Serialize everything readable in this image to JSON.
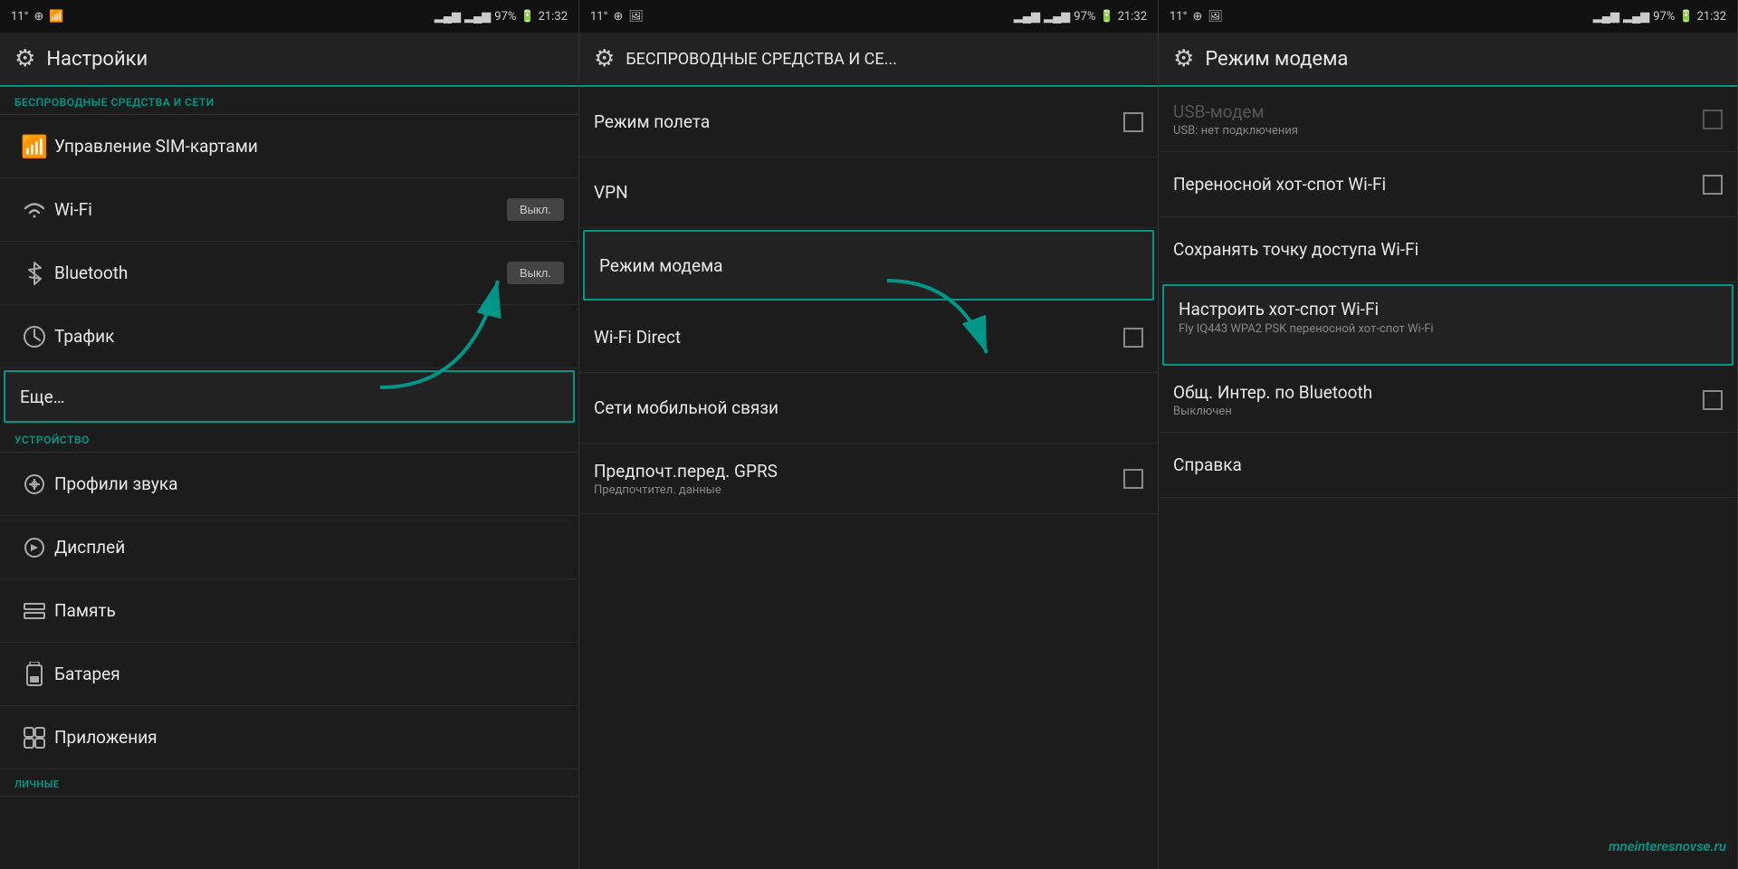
{
  "panels": [
    {
      "id": "panel1",
      "statusBar": {
        "left": "11°",
        "leftIcons": [
          "⊕",
          "📶"
        ],
        "signal": "▂▄▆",
        "signal2": "▂▄▆",
        "battery": "97%",
        "batteryIcon": "🔋",
        "time": "21:32"
      },
      "header": {
        "icon": "⚙",
        "title": "Настройки"
      },
      "sections": [
        {
          "label": "БЕСПРОВОДНЫЕ СРЕДСТВА И СЕТИ",
          "items": [
            {
              "icon": "📶",
              "iconType": "sim",
              "title": "Управление SIM-картами",
              "right": null,
              "subtitle": null,
              "highlighted": false
            },
            {
              "icon": "wifi",
              "title": "Wi-Fi",
              "right": "toggle",
              "toggleLabel": "Выкл.",
              "subtitle": null,
              "highlighted": false
            },
            {
              "icon": "bluetooth",
              "title": "Bluetooth",
              "right": "toggle",
              "toggleLabel": "Выкл.",
              "subtitle": null,
              "highlighted": false
            },
            {
              "icon": "traffic",
              "title": "Трафик",
              "right": null,
              "subtitle": null,
              "highlighted": false
            },
            {
              "icon": null,
              "title": "Еще…",
              "right": null,
              "subtitle": null,
              "highlighted": true
            }
          ]
        },
        {
          "label": "УСТРОЙСТВО",
          "items": [
            {
              "icon": "sound",
              "title": "Профили звука",
              "right": null,
              "subtitle": null,
              "highlighted": false
            },
            {
              "icon": "display",
              "title": "Дисплей",
              "right": null,
              "subtitle": null,
              "highlighted": false
            },
            {
              "icon": "memory",
              "title": "Память",
              "right": null,
              "subtitle": null,
              "highlighted": false
            },
            {
              "icon": "battery",
              "title": "Батарея",
              "right": null,
              "subtitle": null,
              "highlighted": false
            },
            {
              "icon": "apps",
              "title": "Приложения",
              "right": null,
              "subtitle": null,
              "highlighted": false
            }
          ]
        },
        {
          "label": "ЛИЧНЫЕ",
          "items": []
        }
      ]
    },
    {
      "id": "panel2",
      "statusBar": {
        "left": "11°",
        "time": "21:32"
      },
      "header": {
        "icon": "⚙",
        "title": "БЕСПРОВОДНЫЕ СРЕДСТВА И СЕ..."
      },
      "sections": [
        {
          "label": null,
          "items": [
            {
              "icon": null,
              "title": "Режим полета",
              "right": "checkbox",
              "subtitle": null,
              "highlighted": false
            },
            {
              "icon": null,
              "title": "VPN",
              "right": null,
              "subtitle": null,
              "highlighted": false
            },
            {
              "icon": null,
              "title": "Режим модема",
              "right": null,
              "subtitle": null,
              "highlighted": true
            },
            {
              "icon": null,
              "title": "Wi-Fi Direct",
              "right": "checkbox",
              "subtitle": null,
              "highlighted": false
            },
            {
              "icon": null,
              "title": "Сети мобильной связи",
              "right": null,
              "subtitle": null,
              "highlighted": false
            },
            {
              "icon": null,
              "title": "Предпочт.перед. GPRS",
              "right": "checkbox",
              "subtitle": "Предпочтител. данные",
              "highlighted": false
            }
          ]
        }
      ]
    },
    {
      "id": "panel3",
      "statusBar": {
        "left": "11°",
        "time": "21:32"
      },
      "header": {
        "icon": "⚙",
        "title": "Режим модема"
      },
      "sections": [
        {
          "label": null,
          "items": [
            {
              "icon": null,
              "title": "USB-модем",
              "right": "checkbox",
              "subtitle": "USB: нет подключения",
              "highlighted": false,
              "disabled": true
            },
            {
              "icon": null,
              "title": "Переносной хот-спот Wi-Fi",
              "right": "checkbox",
              "subtitle": null,
              "highlighted": false
            },
            {
              "icon": null,
              "title": "Сохранять точку доступа Wi-Fi",
              "right": null,
              "subtitle": null,
              "highlighted": false
            },
            {
              "icon": null,
              "title": "Настроить хот-спот Wi-Fi",
              "right": null,
              "subtitle": "Fly IQ443 WPA2 PSK переносной хот-спот Wi-Fi",
              "highlighted": true
            },
            {
              "icon": null,
              "title": "Общ. Интер. по Bluetooth",
              "right": "checkbox",
              "subtitle": "Выключен",
              "highlighted": false
            },
            {
              "icon": null,
              "title": "Справка",
              "right": null,
              "subtitle": null,
              "highlighted": false
            }
          ]
        }
      ],
      "watermark": "mneinteresnovse.ru"
    }
  ],
  "arrows": [
    {
      "from": "panel1-еще",
      "to": "panel2-режим-модема"
    },
    {
      "from": "panel2-режим-модема",
      "to": "panel3-настроить"
    }
  ]
}
